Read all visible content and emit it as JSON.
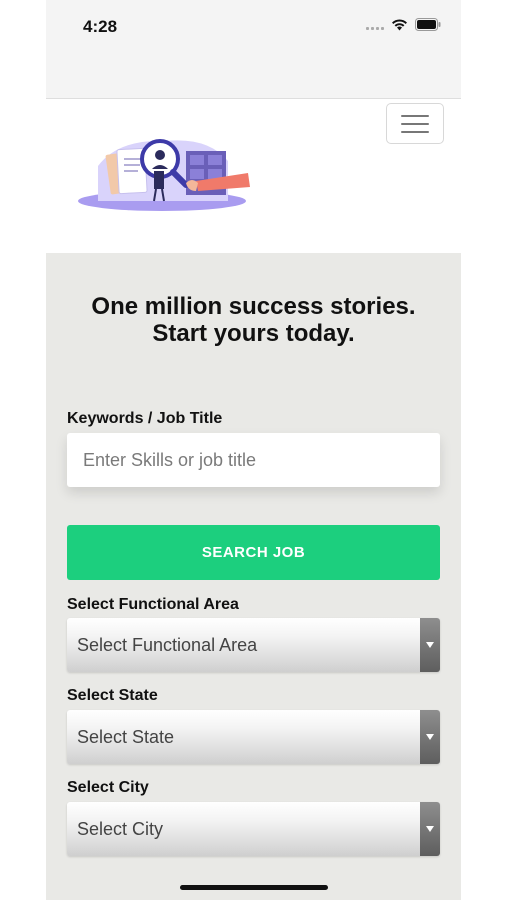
{
  "status_bar": {
    "time": "4:28",
    "icons": [
      "signal-icon",
      "wifi-icon",
      "battery-icon"
    ]
  },
  "header": {
    "logo_icon": "hiring-logo-illustration",
    "menu_icon": "hamburger-menu-icon"
  },
  "main": {
    "headline_line1": "One million success stories.",
    "headline_line2": "Start yours today.",
    "keywords": {
      "label": "Keywords / Job Title",
      "placeholder": "Enter Skills or job title",
      "value": ""
    },
    "search_button_label": "SEARCH JOB",
    "functional_area": {
      "label": "Select Functional Area",
      "selected": "Select Functional Area"
    },
    "state": {
      "label": "Select State",
      "selected": "Select State"
    },
    "city": {
      "label": "Select City",
      "selected": "Select City"
    }
  },
  "colors": {
    "accent_green": "#1ccf7e",
    "page_background": "#e9e9e6",
    "logo_purple": "#8a7be0",
    "logo_coral": "#f07a6a"
  }
}
